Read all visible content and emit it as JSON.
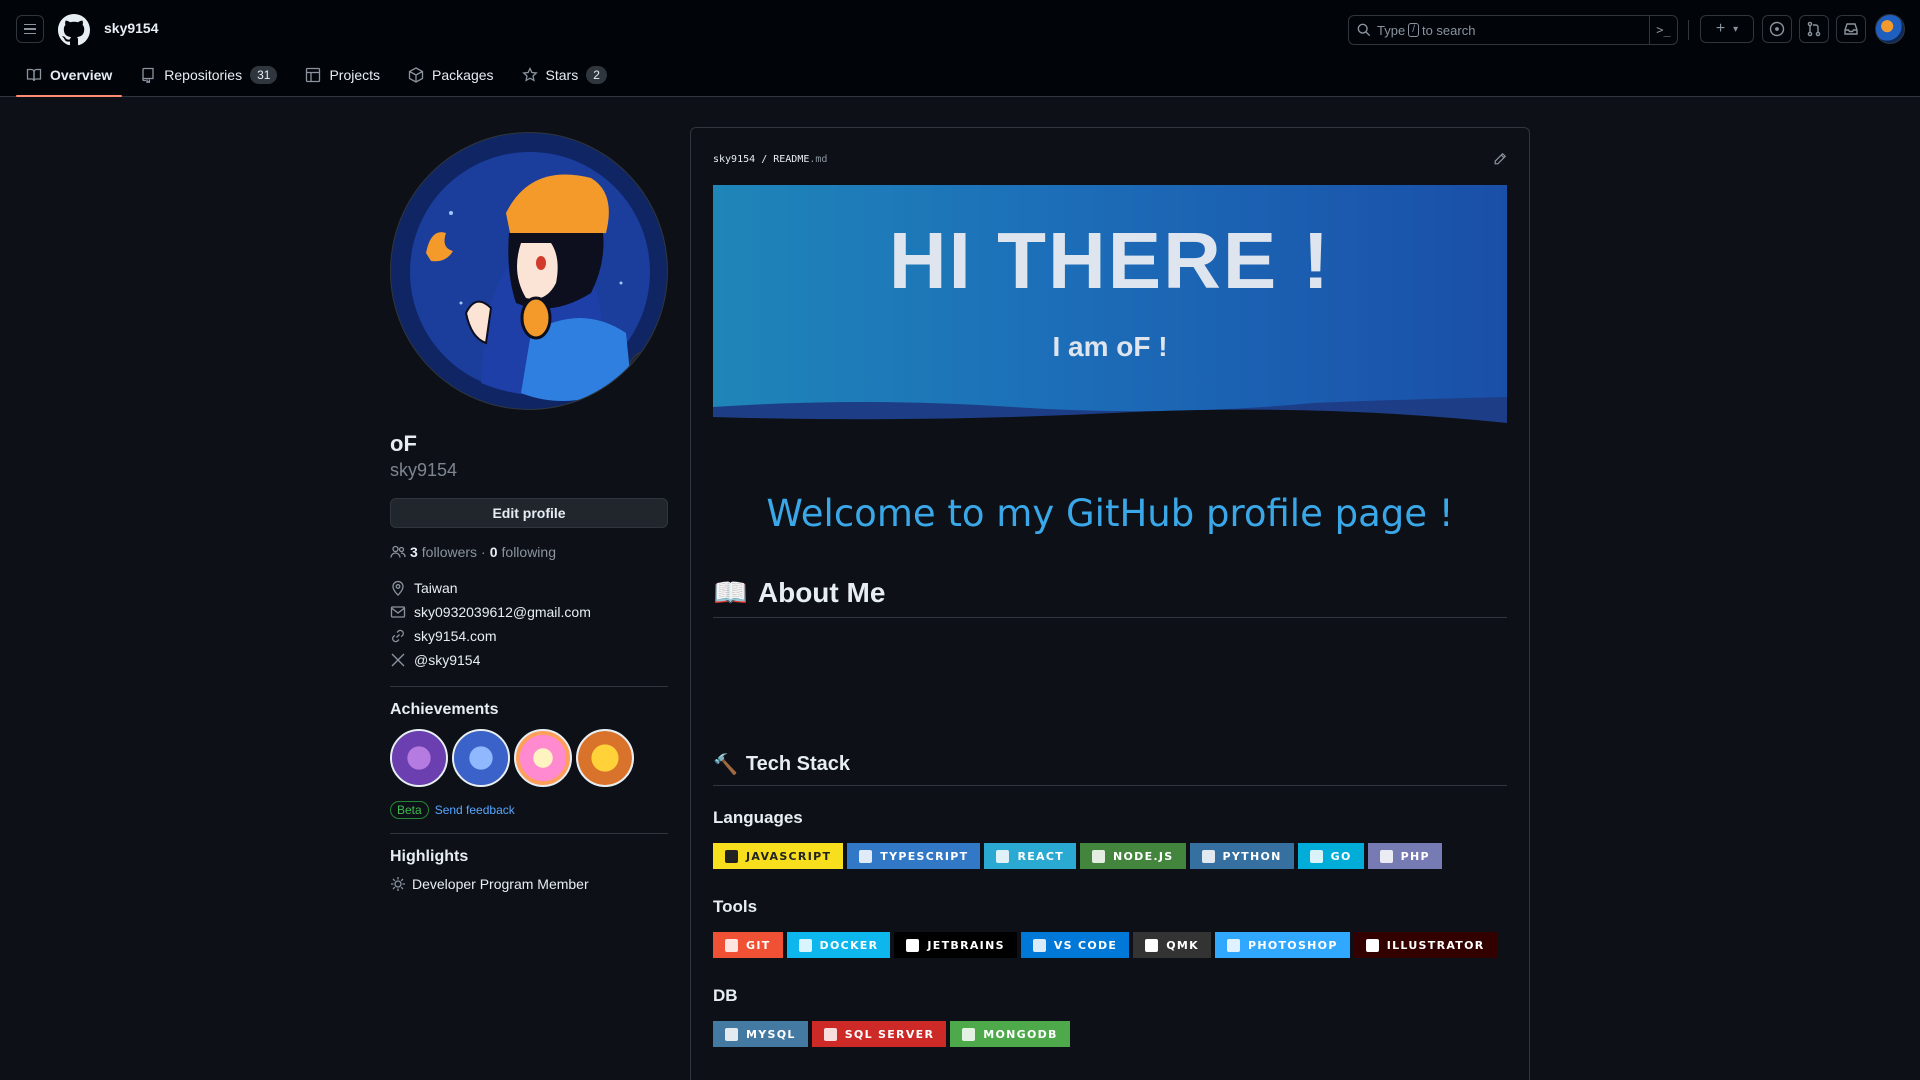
{
  "header": {
    "username": "sky9154",
    "search_prefix": "Type",
    "search_key": "/",
    "search_suffix": "to search",
    "command_symbol": ">_",
    "plus_symbol": "+",
    "caret_symbol": "▾"
  },
  "tabs": [
    {
      "label": "Overview",
      "icon": "book-icon",
      "active": true
    },
    {
      "label": "Repositories",
      "icon": "repo-icon",
      "count": "31"
    },
    {
      "label": "Projects",
      "icon": "table-icon"
    },
    {
      "label": "Packages",
      "icon": "package-icon"
    },
    {
      "label": "Stars",
      "icon": "star-icon",
      "count": "2"
    }
  ],
  "profile": {
    "name": "oF",
    "login": "sky9154",
    "edit_label": "Edit profile",
    "followers_count": "3",
    "followers_label": "followers",
    "separator": "·",
    "following_count": "0",
    "following_label": "following",
    "location": "Taiwan",
    "email": "sky0932039612@gmail.com",
    "website": "sky9154.com",
    "x_handle": "@sky9154",
    "achievements_title": "Achievements",
    "beta_label": "Beta",
    "feedback_label": "Send feedback",
    "highlights_title": "Highlights",
    "highlight_item": "Developer Program Member"
  },
  "readme": {
    "owner": "sky9154",
    "slash": "/",
    "file_name": "README",
    "file_ext": ".md",
    "banner_title": "HI THERE !",
    "banner_subtitle": "I am oF !",
    "welcome": "Welcome to my GitHub profile page !",
    "about_emoji": "📖",
    "about_title": "About Me",
    "tech_emoji": "🔨",
    "tech_title": "Tech Stack",
    "languages_title": "Languages",
    "tools_title": "Tools",
    "db_title": "DB"
  },
  "languages": [
    {
      "label": "JAVASCRIPT",
      "color": "#f7df1e",
      "style": "yellow"
    },
    {
      "label": "TYPESCRIPT",
      "color": "#3178c6"
    },
    {
      "label": "REACT",
      "color": "#20232a",
      "text_color": "#61dafb",
      "bg": "#2aa9d2"
    },
    {
      "label": "NODE.JS",
      "color": "#43853d"
    },
    {
      "label": "PYTHON",
      "color": "#3670a0"
    },
    {
      "label": "GO",
      "color": "#00add8"
    },
    {
      "label": "PHP",
      "color": "#777bb4"
    }
  ],
  "tools": [
    {
      "label": "GIT",
      "color": "#f05033"
    },
    {
      "label": "DOCKER",
      "color": "#0db7ed"
    },
    {
      "label": "JETBRAINS",
      "color": "#000000"
    },
    {
      "label": "VS CODE",
      "color": "#0078d7"
    },
    {
      "label": "QMK",
      "color": "#333333"
    },
    {
      "label": "PHOTOSHOP",
      "color": "#31a8ff"
    },
    {
      "label": "ILLUSTRATOR",
      "color": "#330000"
    }
  ],
  "db": [
    {
      "label": "MYSQL",
      "color": "#4479a1"
    },
    {
      "label": "SQL SERVER",
      "color": "#cc2927"
    },
    {
      "label": "MONGODB",
      "color": "#4ea94b"
    }
  ]
}
